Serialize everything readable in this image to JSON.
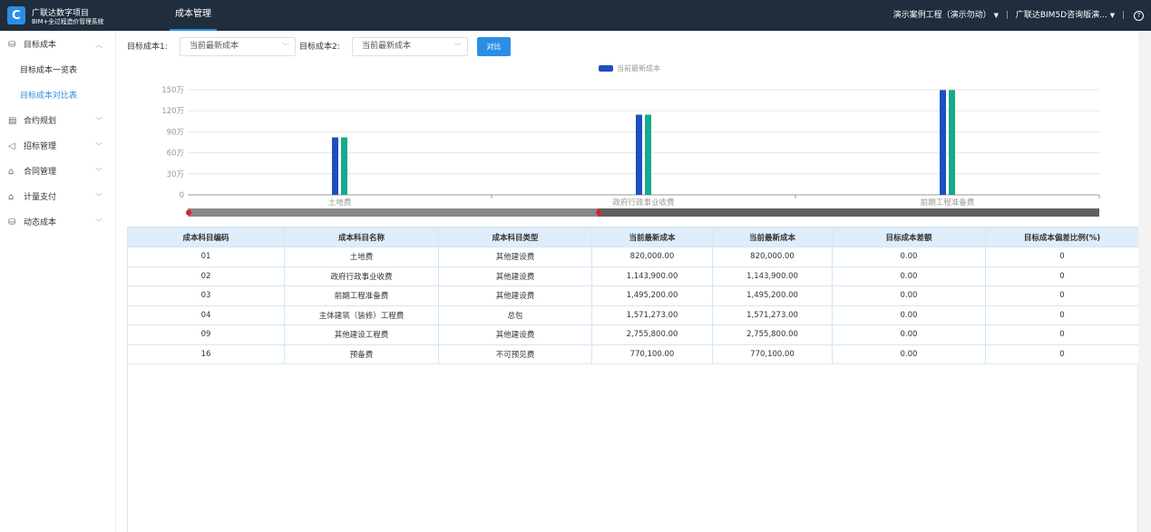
{
  "header": {
    "brand_line1": "广联达数字项目",
    "brand_line2": "BIM+全过程造价管理系统",
    "module_title": "成本管理",
    "project_selector": "演示案例工程（演示勿动）",
    "org_selector": "广联达BIM5D咨询版演...",
    "help_symbol": "?"
  },
  "sidebar": {
    "items": [
      {
        "icon": "database-icon",
        "label": "目标成本",
        "expanded": true,
        "children": [
          {
            "label": "目标成本一览表",
            "active": false
          },
          {
            "label": "目标成本对比表",
            "active": true
          }
        ]
      },
      {
        "icon": "document-icon",
        "label": "合约规划"
      },
      {
        "icon": "send-icon",
        "label": "招标管理"
      },
      {
        "icon": "folder-icon",
        "label": "合同管理"
      },
      {
        "icon": "folder-icon",
        "label": "计量支付"
      },
      {
        "icon": "database-icon",
        "label": "动态成本"
      }
    ]
  },
  "filters": {
    "cost1_label": "目标成本1:",
    "cost1_value": "当前最新成本",
    "cost2_label": "目标成本2:",
    "cost2_value": "当前最新成本",
    "compare_button": "对比"
  },
  "chart_data": {
    "type": "bar",
    "legend": [
      "当前最新成本"
    ],
    "categories": [
      "土地费",
      "政府行政事业收费",
      "前期工程准备费"
    ],
    "series": [
      {
        "name": "当前最新成本",
        "values": [
          820000,
          1143900,
          1495200
        ],
        "color": "#1e4fc1"
      },
      {
        "values": [
          820000,
          1143900,
          1495200
        ],
        "color": "#16a98e"
      }
    ],
    "yticks": [
      "0",
      "30万",
      "60万",
      "90万",
      "120万",
      "150万"
    ],
    "ylim": [
      0,
      1500000
    ],
    "grid": true
  },
  "table": {
    "headers": [
      "成本科目编码",
      "成本科目名称",
      "成本科目类型",
      "当前最新成本",
      "当前最新成本",
      "目标成本差额",
      "目标成本偏差比例(%)"
    ],
    "rows": [
      [
        "01",
        "土地费",
        "其他建设费",
        "820,000.00",
        "820,000.00",
        "0.00",
        "0"
      ],
      [
        "02",
        "政府行政事业收费",
        "其他建设费",
        "1,143,900.00",
        "1,143,900.00",
        "0.00",
        "0"
      ],
      [
        "03",
        "前期工程准备费",
        "其他建设费",
        "1,495,200.00",
        "1,495,200.00",
        "0.00",
        "0"
      ],
      [
        "04",
        "主体建筑（装修）工程费",
        "总包",
        "1,571,273.00",
        "1,571,273.00",
        "0.00",
        "0"
      ],
      [
        "09",
        "其他建设工程费",
        "其他建设费",
        "2,755,800.00",
        "2,755,800.00",
        "0.00",
        "0"
      ],
      [
        "16",
        "预备费",
        "不可预见费",
        "770,100.00",
        "770,100.00",
        "0.00",
        "0"
      ]
    ]
  },
  "colors": {
    "topbar": "#1f2d3d",
    "accent": "#2b8ee6",
    "header_row": "#deedf9"
  }
}
